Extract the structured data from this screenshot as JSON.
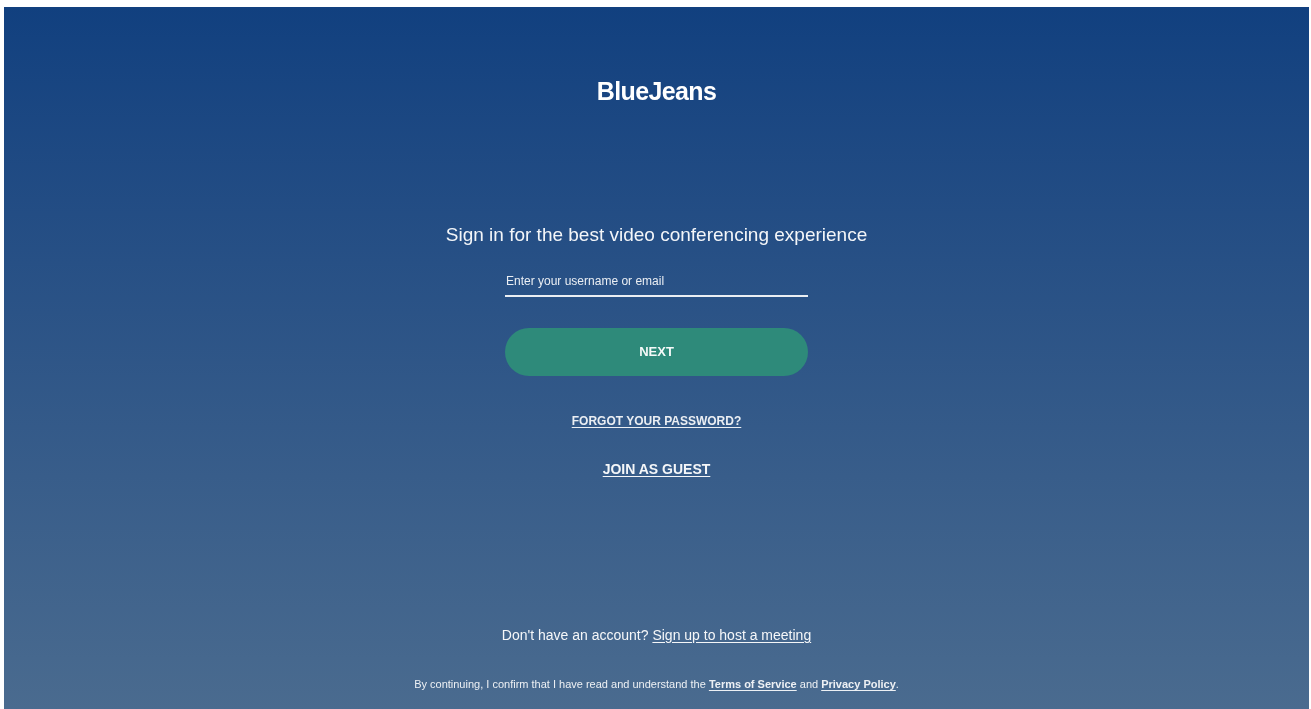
{
  "logo": "BlueJeans",
  "heading": "Sign in for the best video conferencing experience",
  "username_field": {
    "placeholder": "Enter your username or email"
  },
  "next_button": "NEXT",
  "forgot_link": "FORGOT YOUR PASSWORD?",
  "guest_link": "JOIN AS GUEST",
  "signup": {
    "prompt": "Don't have an account?",
    "link": "Sign up to host a meeting"
  },
  "legal": {
    "before": "By continuing, I confirm that I have read and understand the",
    "terms_link": "Terms of Service",
    "middle": "and",
    "privacy_link": "Privacy Policy",
    "after": "."
  }
}
